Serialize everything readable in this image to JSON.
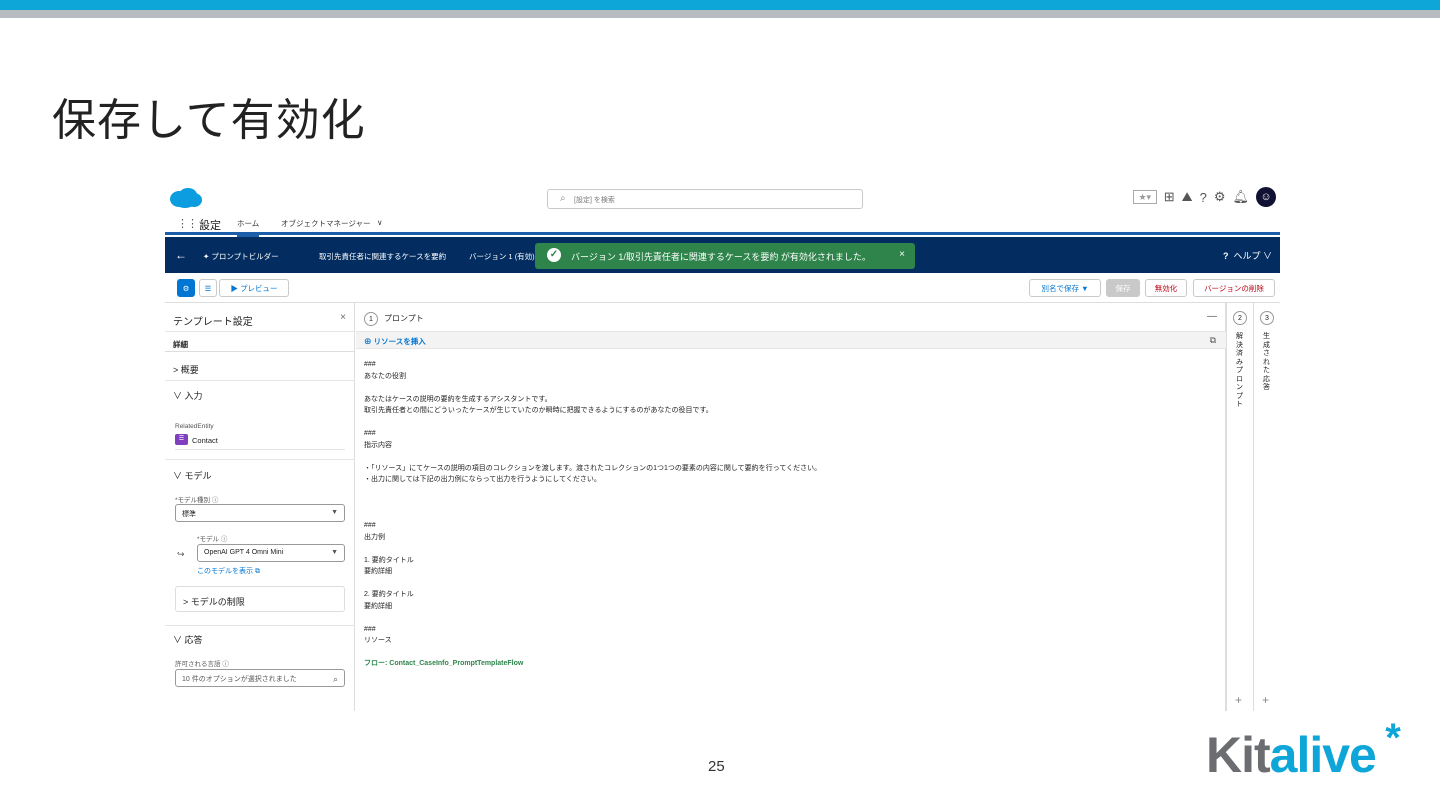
{
  "slide": {
    "title": "保存して有効化",
    "page_number": "25",
    "logo_kit": "Kit",
    "logo_alive": "alive",
    "logo_star": "*"
  },
  "global_header": {
    "search_placeholder": "[設定] を検索",
    "search_icon": "search-icon",
    "help_label": "ヘルプ"
  },
  "nav": {
    "app_name": "設定",
    "tabs": [
      "ホーム",
      "オブジェクトマネージャー"
    ]
  },
  "builder_bar": {
    "back_icon": "back-arrow-icon",
    "title": "プロンプトビルダー",
    "template_name": "取引先責任者に関連するケースを要約",
    "version": "バージョン 1 (有効)",
    "help": "?",
    "help_label": "ヘルプ"
  },
  "toast": {
    "message": "バージョン 1/取引先責任者に関連するケースを要約 が有効化されました。",
    "close": "×",
    "color": "#2e844a"
  },
  "toolbar": {
    "preview_label": "▶ プレビュー",
    "save_as_label": "別名で保存 ▼",
    "save_label": "保存",
    "deactivate_label": "無効化",
    "delete_version_label": "バージョンの削除"
  },
  "left_panel": {
    "header": "テンプレート設定",
    "close": "×",
    "detail_tab": "詳細",
    "overview": "> 概要",
    "input": "∨ 入力",
    "related_entity_label": "RelatedEntity",
    "related_entity_value": "Contact",
    "model_section": "∨ モデル",
    "model_type_label": "*モデル種別",
    "model_type_value": "標準",
    "model_label": "*モデル",
    "model_value": "OpenAI GPT 4 Omni Mini",
    "view_model_link": "このモデルを表示",
    "model_limits": "> モデルの制限",
    "response_section": "∨ 応答",
    "languages_label": "許可される言語",
    "languages_value": "10 件のオプションが選択されました"
  },
  "main_panel": {
    "step_number": "1",
    "step_label": "プロンプト",
    "insert_resource": "リソースを挿入",
    "lines": [
      "###",
      "あなたの役割",
      "",
      "あなたはケースの説明の要約を生成するアシスタントです。",
      "取引先責任者との間にどういったケースが生じていたのか瞬時に把握できるようにするのがあなたの役目です。",
      "",
      "###",
      "指示内容",
      "",
      "・「リソース」にてケースの説明の項目のコレクションを渡します。渡されたコレクションの1つ1つの要素の内容に関して要約を行ってください。",
      "・出力に関しては下記の出力例にならって出力を行うようにしてください。",
      "",
      "",
      "",
      "###",
      "出力例",
      "",
      "1. 要約タイトル",
      "要約詳細",
      "",
      "2. 要約タイトル",
      "要約詳細",
      "",
      "###",
      "リソース",
      ""
    ],
    "flow_prefix": "フロー: ",
    "flow_name": "Contact_CaseInfo_PromptTemplateFlow"
  },
  "right_columns": [
    {
      "number": "2",
      "label": "解決済みプロンプト"
    },
    {
      "number": "3",
      "label": "生成された応答"
    }
  ]
}
